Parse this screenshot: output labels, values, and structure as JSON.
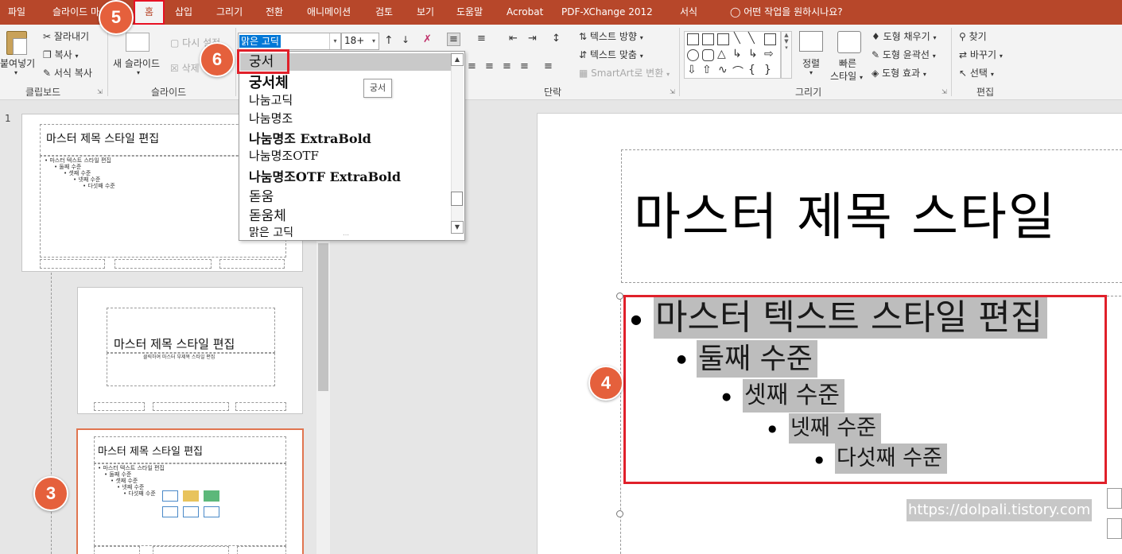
{
  "tabs": [
    "파일",
    "슬라이드 마",
    "홈",
    "삽입",
    "그리기",
    "전환",
    "애니메이션",
    "검토",
    "보기",
    "도움말",
    "Acrobat",
    "PDF-XChange 2012",
    "서식"
  ],
  "tell_me": "어떤 작업을 원하시나요?",
  "clipboard": {
    "paste": "붙여넣기",
    "cut": "잘라내기",
    "copy": "복사",
    "format_painter": "서식 복사",
    "group": "클립보드"
  },
  "slides_group": {
    "new_slide": "새 슬라이드",
    "reset": "다시 설정",
    "delete": "삭제",
    "group": "슬라이드"
  },
  "font": {
    "current": "맑은 고딕",
    "size": "18+"
  },
  "paragraph": {
    "text_direction": "텍스트 방향",
    "align_text": "텍스트 맞춤",
    "smartart": "SmartArt로 변환",
    "group": "단락"
  },
  "drawing": {
    "arrange": "정렬",
    "quick_styles_1": "빠른",
    "quick_styles_2": "스타일",
    "shape_fill": "도형 채우기",
    "shape_outline": "도형 윤곽선",
    "shape_effects": "도형 효과",
    "group": "그리기"
  },
  "editing": {
    "find": "찾기",
    "replace": "바꾸기",
    "select": "선택",
    "group": "편집"
  },
  "font_list": [
    "궁서",
    "궁서체",
    "나눔고딕",
    "나눔명조",
    "나눔명조 ExtraBold",
    "나눔명조OTF",
    "나눔명조OTF ExtraBold",
    "돋움",
    "돋움체",
    "맑은 고딕"
  ],
  "tooltip": "궁서",
  "thumbnails": {
    "slide_number": "1",
    "title": "마스터 제목 스타일 편집",
    "subtitle": "클릭하여 마스터 부제목 스타일 편집",
    "levels": [
      "마스터 텍스트 스타일 편집",
      "둘째 수준",
      "셋째 수준",
      "넷째 수준",
      "다섯째 수준"
    ]
  },
  "slide": {
    "title": "마스터 제목 스타일",
    "levels": [
      "마스터 텍스트 스타일 편집",
      "둘째 수준",
      "셋째 수준",
      "넷째 수준",
      "다섯째 수준"
    ]
  },
  "watermark": "https://dolpali.tistory.com",
  "badges": [
    "5",
    "6",
    "4",
    "3"
  ],
  "colors": {
    "ribbon": "#b7472a",
    "highlight_box": "#e0202a",
    "badge": "#e5603c"
  }
}
